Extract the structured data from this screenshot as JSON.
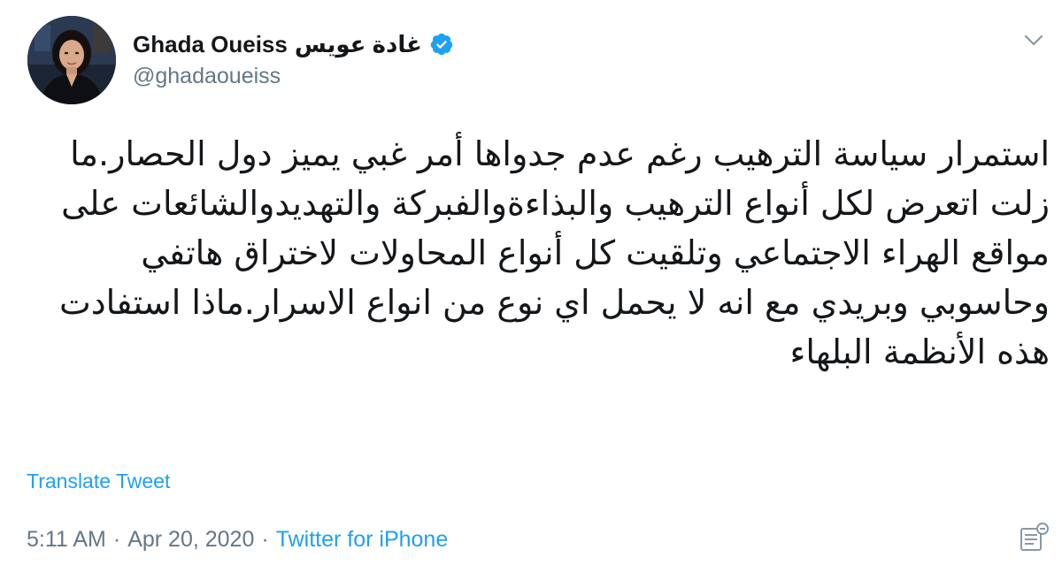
{
  "author": {
    "display_name": "Ghada Oueiss",
    "display_name_arabic": "غادة عويس",
    "handle": "@ghadaoueiss",
    "verified": true,
    "avatar_icon": "profile-photo"
  },
  "tweet": {
    "text": "استمرار سياسة الترهيب رغم عدم جدواها أمر غبي يميز دول الحصار.ما زلت اتعرض لكل أنواع الترهيب والبذاءةوالفبركة والتهديدوالشائعات على مواقع الهراء الاجتماعي وتلقيت كل أنواع المحاولات لاختراق هاتفي وحاسوبي وبريدي مع انه لا يحمل اي نوع من انواع الاسرار.ماذا استفادت هذه الأنظمة البلهاء",
    "translate_label": "Translate Tweet",
    "time": "5:11 AM",
    "date": "Apr 20, 2020",
    "source": "Twitter for iPhone",
    "separator": "·"
  },
  "icons": {
    "caret": "chevron-down-icon",
    "verified": "verified-badge-icon",
    "analytics": "analytics-icon"
  },
  "colors": {
    "accent": "#1da1f2",
    "text": "#14171a",
    "secondary": "#657786"
  }
}
